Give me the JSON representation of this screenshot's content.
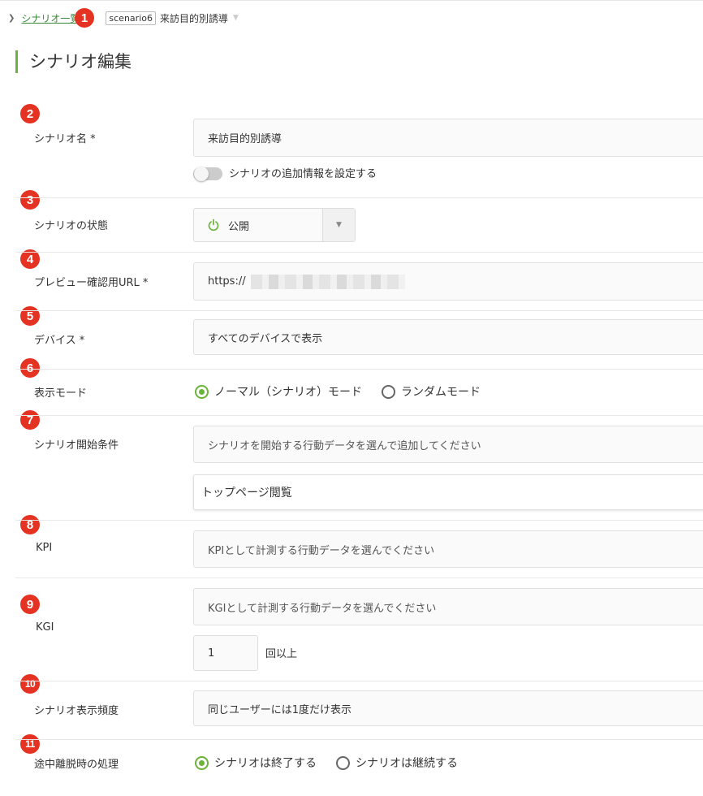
{
  "breadcrumb": {
    "link": "シナリオ一覧",
    "tag": "scenario6",
    "title": "来訪目的別誘導"
  },
  "page_title": "シナリオ編集",
  "badges": [
    "1",
    "2",
    "3",
    "4",
    "5",
    "6",
    "7",
    "8",
    "9",
    "10",
    "11"
  ],
  "form": {
    "name": {
      "label": "シナリオ名 *",
      "value": "来訪目的別誘導",
      "toggle_label": "シナリオの追加情報を設定する",
      "toggle_on": false
    },
    "status": {
      "label": "シナリオの状態",
      "value": "公開"
    },
    "preview_url": {
      "label": "プレビュー確認用URL *",
      "value": "https://"
    },
    "device": {
      "label": "デバイス *",
      "value": "すべてのデバイスで表示"
    },
    "mode": {
      "label": "表示モード",
      "options": [
        "ノーマル（シナリオ）モード",
        "ランダムモード"
      ],
      "selected": "ノーマル（シナリオ）モード"
    },
    "start_condition": {
      "label": "シナリオ開始条件",
      "placeholder": "シナリオを開始する行動データを選んで追加してください",
      "items": [
        "トップページ閲覧"
      ]
    },
    "kpi": {
      "label": "KPI",
      "placeholder": "KPIとして計測する行動データを選んでください"
    },
    "kgi": {
      "label": "KGI",
      "placeholder": "KGIとして計測する行動データを選んでください",
      "count": "1",
      "count_suffix": "回以上"
    },
    "frequency": {
      "label": "シナリオ表示頻度",
      "value": "同じユーザーには1度だけ表示"
    },
    "exit": {
      "label": "途中離脱時の処理",
      "options": [
        "シナリオは終了する",
        "シナリオは継続する"
      ],
      "selected": "シナリオは終了する"
    }
  },
  "colors": {
    "accent": "#6bb33a",
    "badge": "#e53323",
    "link": "#3a8a3a"
  }
}
